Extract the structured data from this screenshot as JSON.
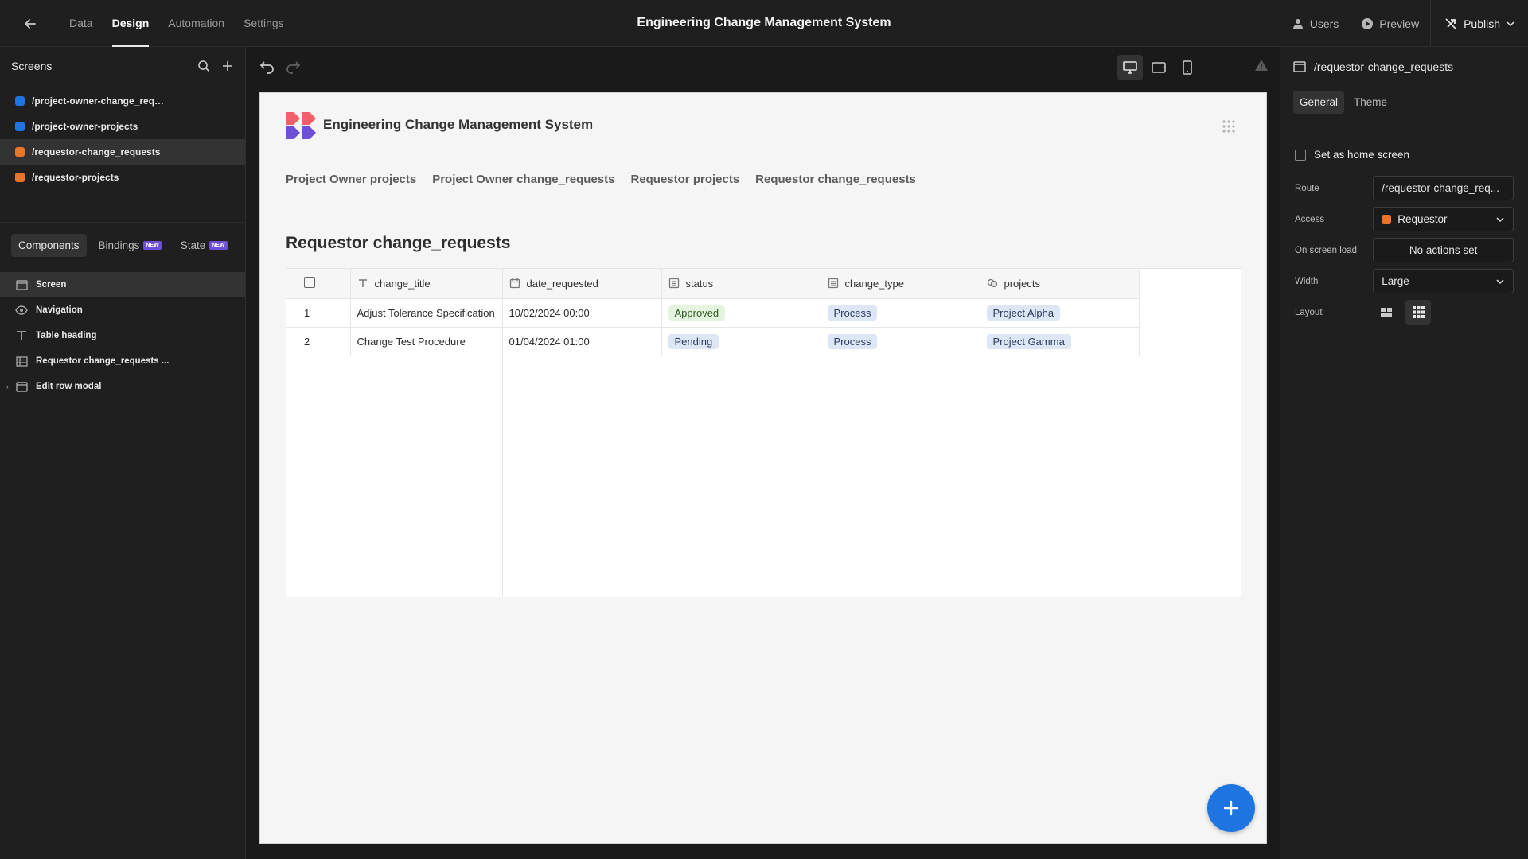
{
  "app_title": "Engineering Change Management System",
  "top_nav": {
    "tabs": [
      "Data",
      "Design",
      "Automation",
      "Settings"
    ],
    "active_tab": "Design",
    "users_label": "Users",
    "preview_label": "Preview",
    "publish_label": "Publish"
  },
  "left_panel": {
    "title": "Screens",
    "screens": [
      {
        "label": "/project-owner-change_requ...",
        "color": "#1e74e0"
      },
      {
        "label": "/project-owner-projects",
        "color": "#1e74e0"
      },
      {
        "label": "/requestor-change_requests",
        "color": "#e8742c"
      },
      {
        "label": "/requestor-projects",
        "color": "#e8742c"
      }
    ],
    "active_screen_index": 2,
    "tabs": {
      "components": "Components",
      "bindings": "Bindings",
      "state": "State",
      "new_badge": "NEW"
    },
    "components": [
      {
        "label": "Screen",
        "icon": "screen-icon"
      },
      {
        "label": "Navigation",
        "icon": "eye-icon"
      },
      {
        "label": "Table heading",
        "icon": "text-icon"
      },
      {
        "label": "Requestor change_requests ...",
        "icon": "table-icon"
      },
      {
        "label": "Edit row modal",
        "icon": "modal-icon"
      }
    ]
  },
  "preview": {
    "brand_title": "Engineering Change Management System",
    "nav_links": [
      "Project Owner projects",
      "Project Owner change_requests",
      "Requestor projects",
      "Requestor change_requests"
    ],
    "heading": "Requestor change_requests",
    "table": {
      "columns": [
        {
          "label": "change_title",
          "icon": "text-type-icon"
        },
        {
          "label": "date_requested",
          "icon": "calendar-icon"
        },
        {
          "label": "status",
          "icon": "options-icon"
        },
        {
          "label": "change_type",
          "icon": "options-icon"
        },
        {
          "label": "projects",
          "icon": "relationship-icon"
        }
      ],
      "rows": [
        {
          "index": "1",
          "change_title": "Adjust Tolerance Specification",
          "date_requested": "10/02/2024 00:00",
          "status": "Approved",
          "change_type": "Process",
          "projects": "Project Alpha"
        },
        {
          "index": "2",
          "change_title": "Change Test Procedure",
          "date_requested": "01/04/2024 01:00",
          "status": "Pending",
          "change_type": "Process",
          "projects": "Project Gamma"
        }
      ]
    },
    "fab_label": "+"
  },
  "right_panel": {
    "route_title": "/requestor-change_requests",
    "tabs": [
      "General",
      "Theme"
    ],
    "active_tab": "General",
    "home_label": "Set as home screen",
    "fields": {
      "route_label": "Route",
      "route_value": "/requestor-change_req...",
      "access_label": "Access",
      "access_value": "Requestor",
      "access_color": "#e8742c",
      "onload_label": "On screen load",
      "onload_value": "No actions set",
      "width_label": "Width",
      "width_value": "Large",
      "layout_label": "Layout"
    }
  }
}
